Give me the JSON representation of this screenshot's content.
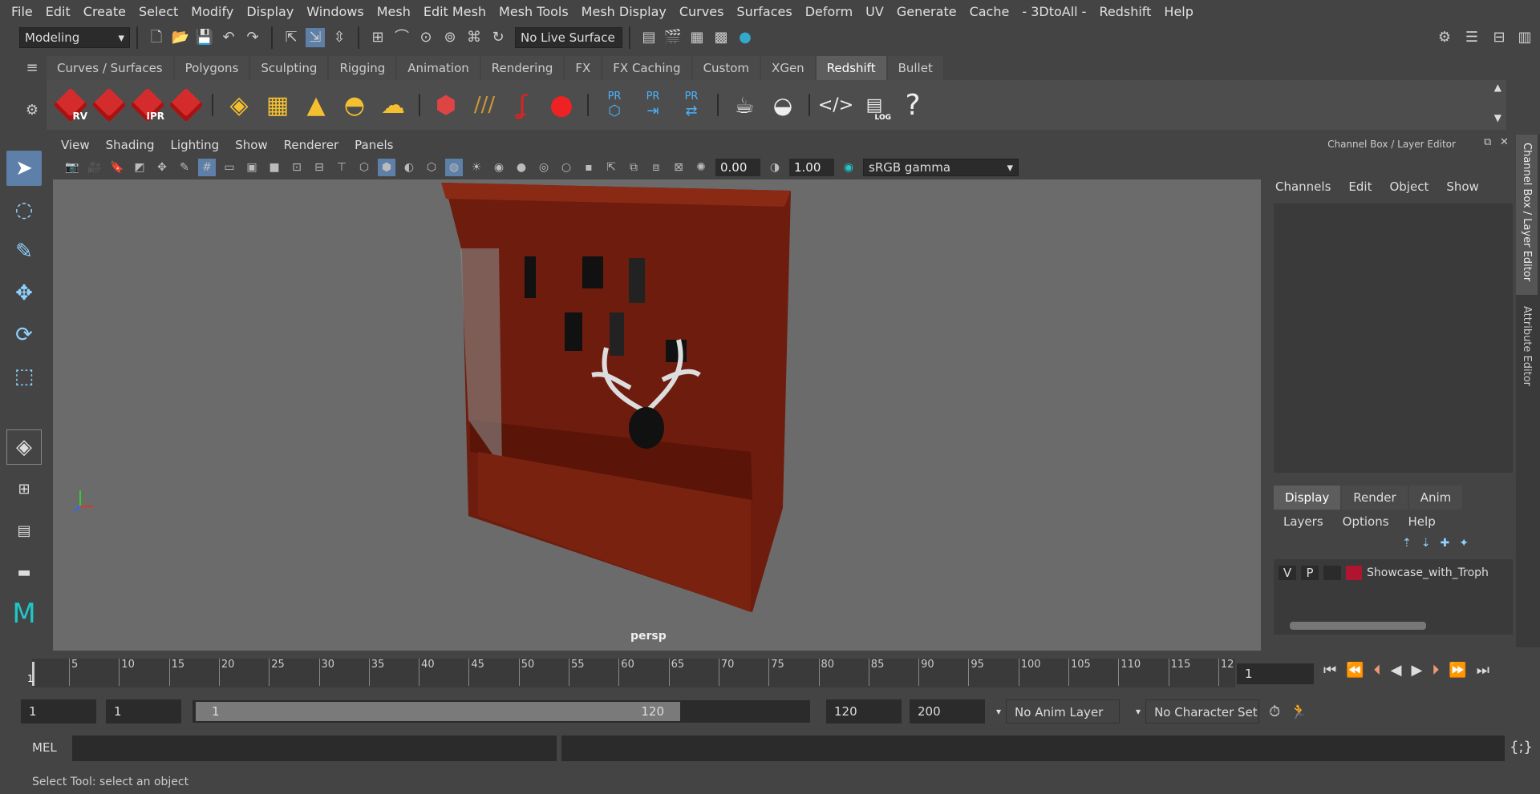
{
  "menu": [
    "File",
    "Edit",
    "Create",
    "Select",
    "Modify",
    "Display",
    "Windows",
    "Mesh",
    "Edit Mesh",
    "Mesh Tools",
    "Mesh Display",
    "Curves",
    "Surfaces",
    "Deform",
    "UV",
    "Generate",
    "Cache",
    "- 3DtoAll -",
    "Redshift",
    "Help"
  ],
  "status": {
    "mode": "Modeling",
    "live_surface": "No Live Surface"
  },
  "shelf_tabs": [
    "Curves / Surfaces",
    "Polygons",
    "Sculpting",
    "Rigging",
    "Animation",
    "Rendering",
    "FX",
    "FX Caching",
    "Custom",
    "XGen",
    "Redshift",
    "Bullet"
  ],
  "active_shelf_tab": "Redshift",
  "shelf_labels": {
    "rv": "RV",
    "ipr": "IPR",
    "pr1": "PR",
    "pr2": "PR",
    "pr3": "PR",
    "log": "LOG"
  },
  "viewport_menu": [
    "View",
    "Shading",
    "Lighting",
    "Show",
    "Renderer",
    "Panels"
  ],
  "viewport_fields": {
    "exposure": "0.00",
    "gamma": "1.00",
    "colorspace": "sRGB gamma"
  },
  "camera_label": "persp",
  "channel_box": {
    "title": "Channel Box / Layer Editor",
    "menu": [
      "Channels",
      "Edit",
      "Object",
      "Show"
    ]
  },
  "layer_editor": {
    "tabs": [
      "Display",
      "Render",
      "Anim"
    ],
    "active_tab": "Display",
    "menu": [
      "Layers",
      "Options",
      "Help"
    ],
    "layer": {
      "v": "V",
      "p": "P",
      "name": "Showcase_with_Troph",
      "color": "#b0142f"
    }
  },
  "side_tabs": [
    "Channel Box / Layer Editor",
    "Attribute Editor"
  ],
  "timeline": {
    "ticks": [
      "5",
      "10",
      "15",
      "20",
      "25",
      "30",
      "35",
      "40",
      "45",
      "50",
      "55",
      "60",
      "65",
      "70",
      "75",
      "80",
      "85",
      "90",
      "95",
      "100",
      "105",
      "110",
      "115",
      "12"
    ],
    "current": "1",
    "frame_field": "1"
  },
  "range": {
    "start": "1",
    "start2": "1",
    "slider_start": "1",
    "slider_end": "120",
    "end": "120",
    "end2": "200",
    "anim_layer": "No Anim Layer",
    "char_set": "No Character Set"
  },
  "mel": {
    "label": "MEL"
  },
  "statusbar": "Select Tool: select an object"
}
